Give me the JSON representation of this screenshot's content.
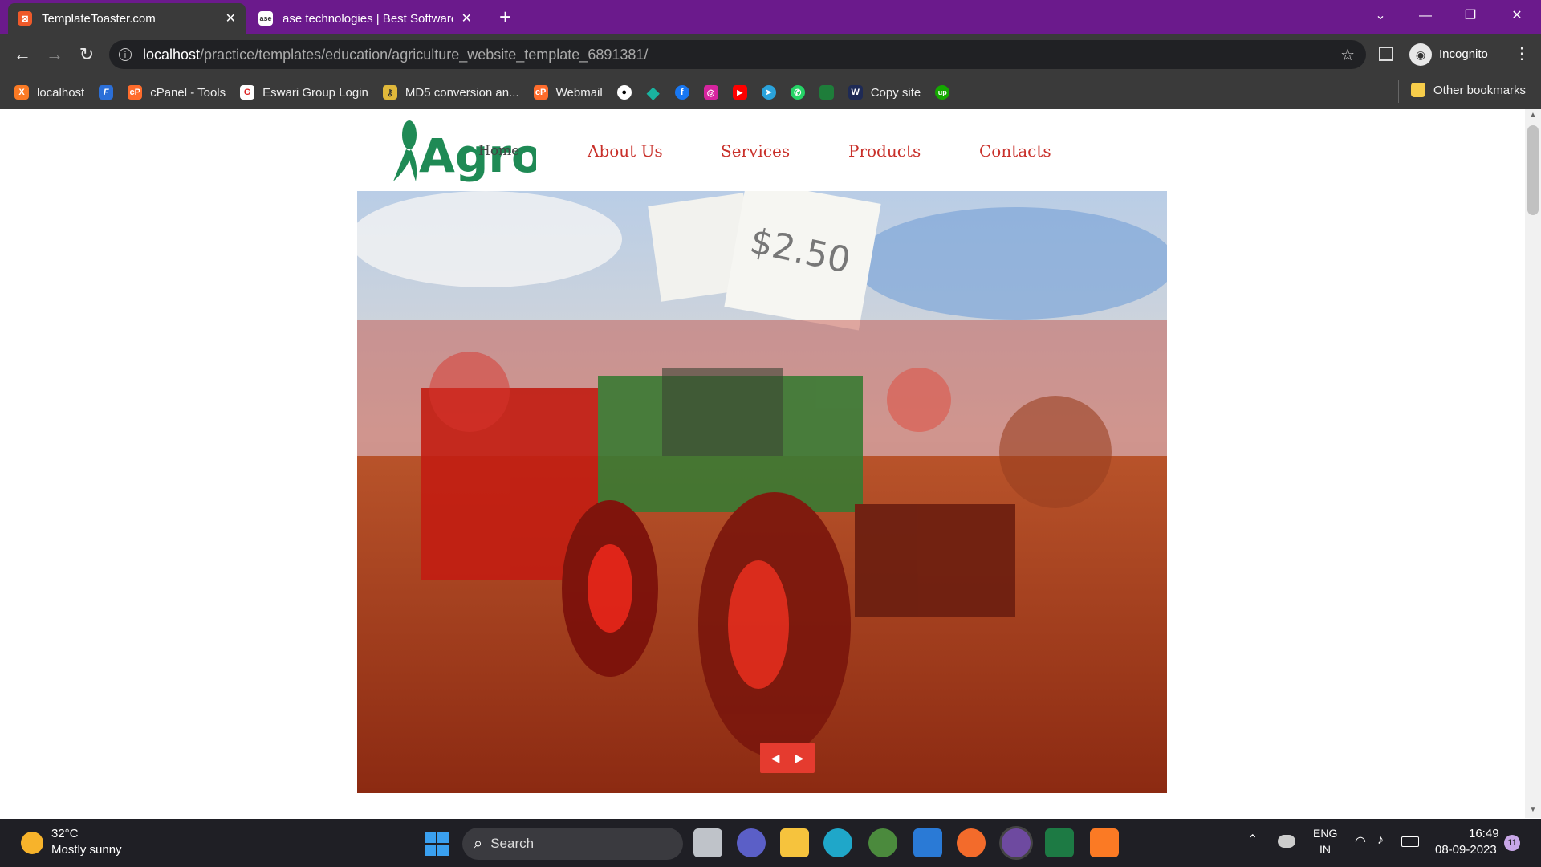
{
  "browser": {
    "tabs": [
      {
        "title": "TemplateToaster.com",
        "favicon": "templatetoaster-icon",
        "active": true
      },
      {
        "title": "ase technologies | Best Software",
        "favicon": "ase-icon",
        "active": false
      }
    ],
    "new_tab_label": "+",
    "url_host": "localhost",
    "url_path": "/practice/templates/education/agriculture_website_template_6891381/",
    "profile_label": "Incognito",
    "bookmarks": [
      {
        "label": "localhost",
        "icon": "xampp-icon"
      },
      {
        "label": "",
        "icon": "f-icon"
      },
      {
        "label": "cPanel - Tools",
        "icon": "cpanel-icon"
      },
      {
        "label": "Eswari Group Login",
        "icon": "eswari-icon"
      },
      {
        "label": "MD5 conversion an...",
        "icon": "key-icon"
      },
      {
        "label": "Webmail",
        "icon": "cpanel-icon"
      },
      {
        "label": "",
        "icon": "github-icon"
      },
      {
        "label": "",
        "icon": "diamond-icon"
      },
      {
        "label": "",
        "icon": "facebook-icon"
      },
      {
        "label": "",
        "icon": "instagram-icon"
      },
      {
        "label": "",
        "icon": "youtube-icon"
      },
      {
        "label": "",
        "icon": "telegram-icon"
      },
      {
        "label": "",
        "icon": "whatsapp-icon"
      },
      {
        "label": "",
        "icon": "folder-green-icon"
      },
      {
        "label": "Copy site",
        "icon": "w-icon"
      },
      {
        "label": "",
        "icon": "upwork-icon"
      }
    ],
    "other_bookmarks": "Other bookmarks"
  },
  "site": {
    "logo_text": "Agro",
    "home_overlap": "Home",
    "nav": [
      "About Us",
      "Services",
      "Products",
      "Contacts"
    ],
    "slider_prev": "◀",
    "slider_next": "▶"
  },
  "taskbar": {
    "weather_temp": "32°C",
    "weather_desc": "Mostly sunny",
    "search_placeholder": "Search",
    "lang_top": "ENG",
    "lang_bottom": "IN",
    "time": "16:49",
    "date": "08-09-2023",
    "notification_count": "11"
  },
  "colors": {
    "titlebar": "#6b1a8c",
    "nav_link": "#c9312b",
    "logo": "#1f8a55"
  }
}
